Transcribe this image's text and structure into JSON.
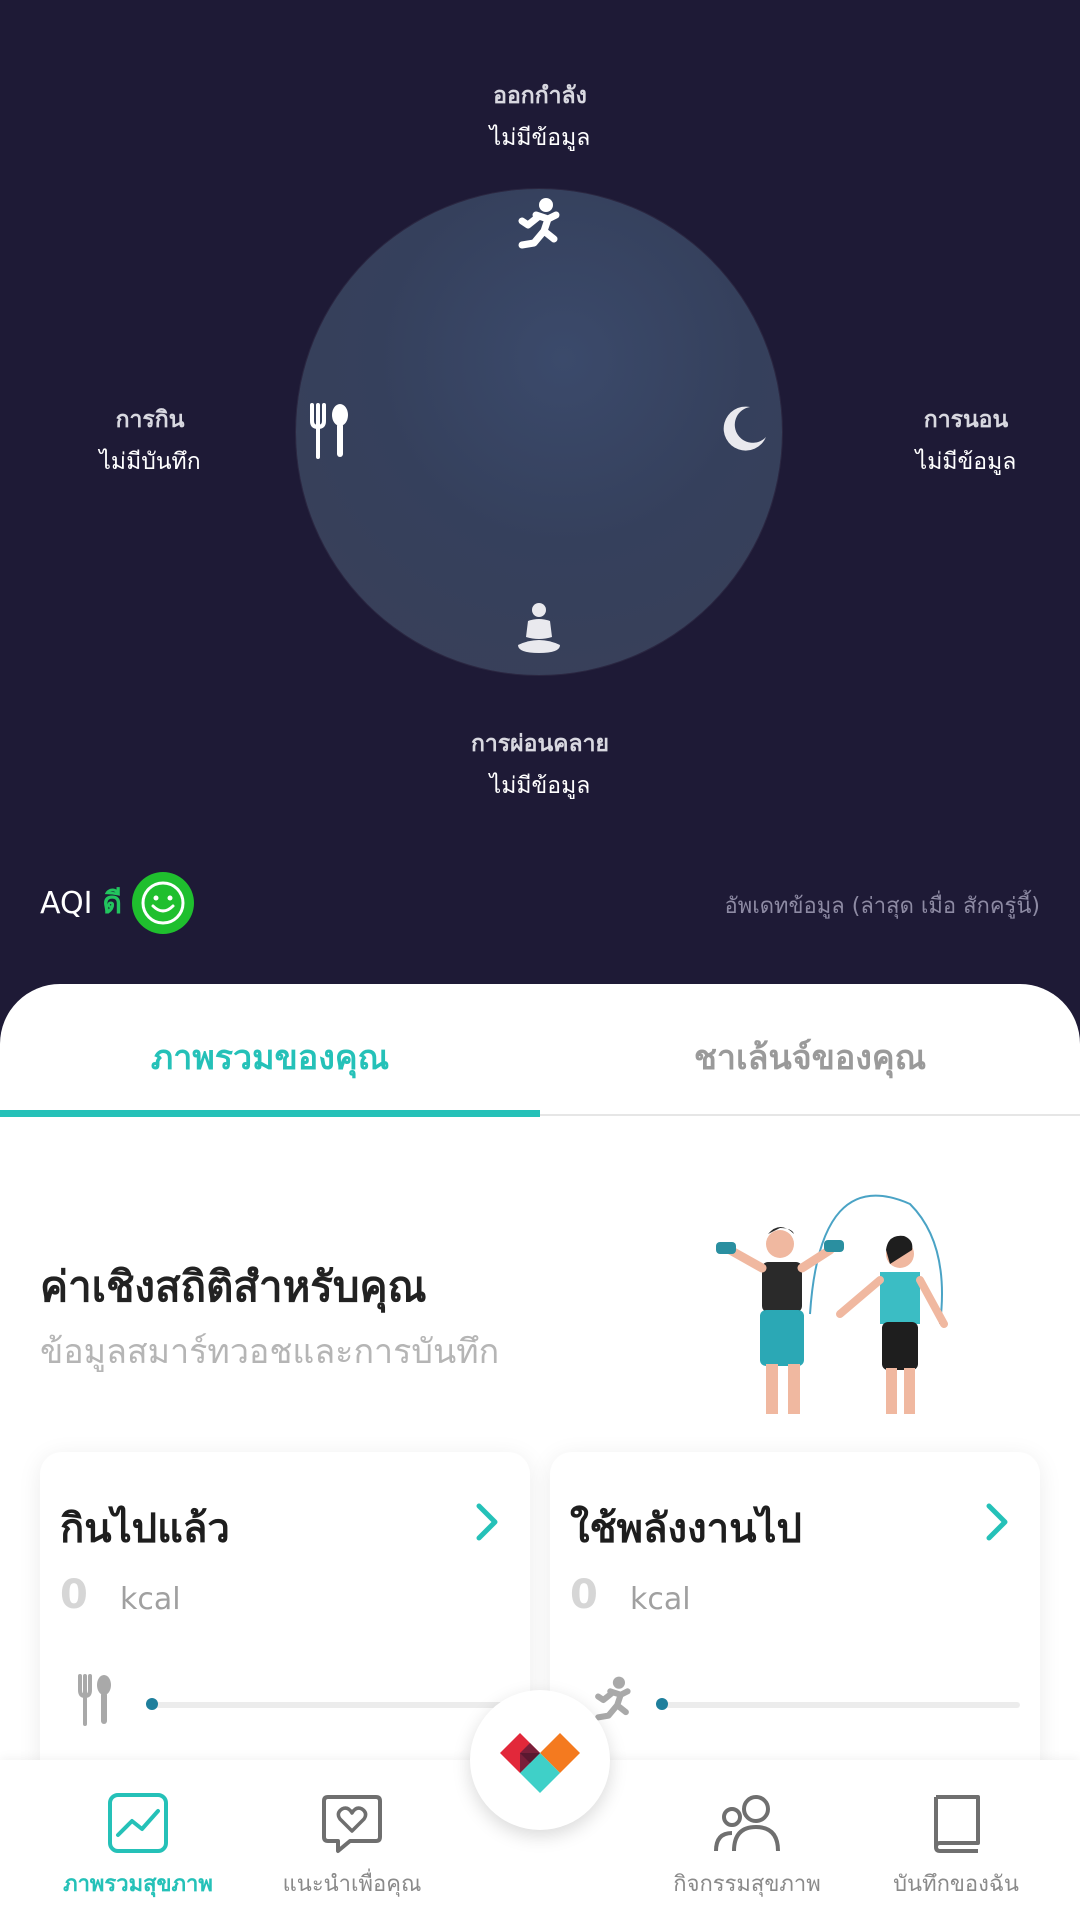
{
  "metrics": {
    "exercise": {
      "label": "ออกกำลัง",
      "value": "ไม่มีข้อมูล"
    },
    "eating": {
      "label": "การกิน",
      "value": "ไม่มีบันทึก"
    },
    "sleep": {
      "label": "การนอน",
      "value": "ไม่มีข้อมูล"
    },
    "relax": {
      "label": "การผ่อนคลาย",
      "value": "ไม่มีข้อมูล"
    }
  },
  "aqi": {
    "label": "AQI",
    "status": "ดี",
    "status_color": "#22c55e"
  },
  "update_text": "อัพเดทข้อมูล (ล่าสุด เมื่อ สักครู่นี้)",
  "tabs": [
    {
      "label": "ภาพรวมของคุณ",
      "active": true
    },
    {
      "label": "ชาเล้นจ์ของคุณ",
      "active": false
    }
  ],
  "stats": {
    "title": "ค่าเชิงสถิติสำหรับคุณ",
    "subtitle": "ข้อมูลสมาร์ทวอชและการบันทึก"
  },
  "cards": [
    {
      "title": "กินไปแล้ว",
      "value": "0",
      "unit": "kcal",
      "icon": "fork-spoon-icon"
    },
    {
      "title": "ใช้พลังงานไป",
      "value": "0",
      "unit": "kcal",
      "icon": "running-icon"
    }
  ],
  "nav": [
    {
      "label": "ภาพรวมสุขภาพ",
      "icon": "chart-icon",
      "active": true
    },
    {
      "label": "แนะนำเพื่อคุณ",
      "icon": "heart-chat-icon",
      "active": false
    },
    {
      "label": "กิจกรรมสุขภาพ",
      "icon": "people-icon",
      "active": false
    },
    {
      "label": "บันทึกของฉัน",
      "icon": "book-icon",
      "active": false
    }
  ],
  "colors": {
    "accent": "#25c1b8",
    "background": "#1e1a36"
  }
}
